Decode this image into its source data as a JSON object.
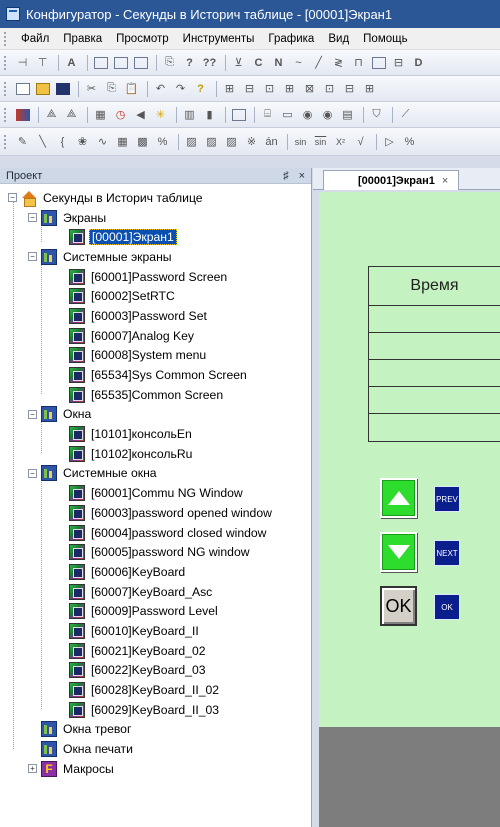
{
  "window": {
    "title": "Конфигуратор - Секунды в Историч таблице  - [00001]Экран1"
  },
  "menu": [
    "Файл",
    "Правка",
    "Просмотр",
    "Инструменты",
    "Графика",
    "Вид",
    "Помощь"
  ],
  "toolbar_text": {
    "t1": [
      "?",
      "??",
      "C",
      "N"
    ],
    "t5": [
      "án",
      "sin",
      "sin",
      "X²"
    ]
  },
  "project_panel": {
    "title": "Проект",
    "pin": "♯",
    "close": "×",
    "root": "Секунды в Историч таблице",
    "screens_group": "Экраны",
    "screens": [
      "[00001]Экран1"
    ],
    "system_screens_group": "Системные экраны",
    "system_screens": [
      "[60001]Password Screen",
      "[60002]SetRTC",
      "[60003]Password Set",
      "[60007]Analog Key",
      "[60008]System menu",
      "[65534]Sys Common Screen",
      "[65535]Common Screen"
    ],
    "windows_group": "Окна",
    "windows": [
      "[10101]консольEn",
      "[10102]консольRu"
    ],
    "system_windows_group": "Системные окна",
    "system_windows": [
      "[60001]Commu NG Window",
      "[60003]password opened window",
      "[60004]password closed window",
      "[60005]password NG window",
      "[60006]KeyBoard",
      "[60007]KeyBoard_Asc",
      "[60009]Password Level",
      "[60010]KeyBoard_II",
      "[60021]KeyBoard_02",
      "[60022]KeyBoard_03",
      "[60028]KeyBoard_II_02",
      "[60029]KeyBoard_II_03"
    ],
    "alarm_windows": "Окна тревог",
    "print_windows": "Окна печати",
    "macros": "Макросы"
  },
  "editor": {
    "tab_label": "[00001]Экран1",
    "tab_close": "×",
    "table_header": "Время",
    "buttons": {
      "prev": "PREV",
      "next": "NEXT",
      "ok_big": "OK",
      "ok_small": "OK"
    }
  },
  "colors": {
    "canvas_bg": "#c4f3c1",
    "arrow_button": "#2edc2e",
    "small_button": "#0a1e8c",
    "selection": "#0b4fb0"
  }
}
